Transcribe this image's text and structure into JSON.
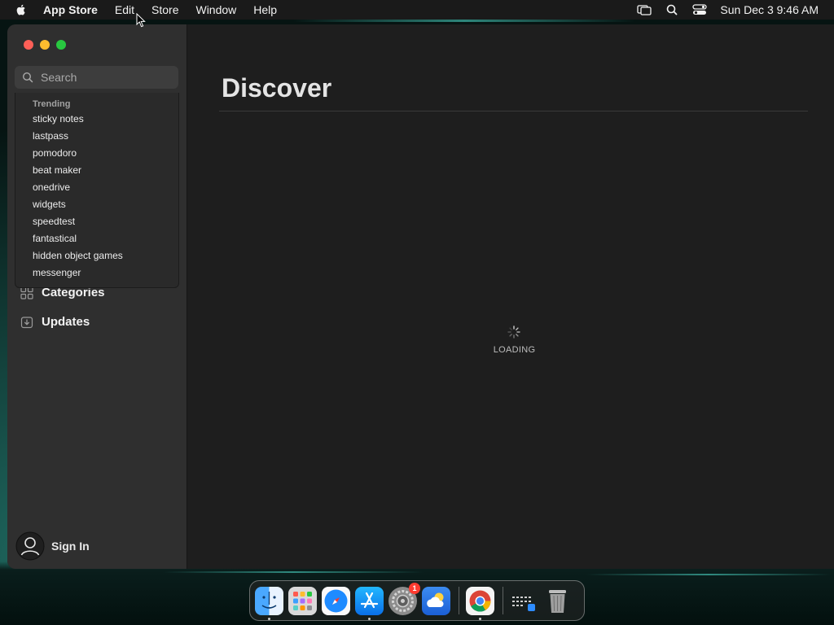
{
  "menubar": {
    "app_name": "App Store",
    "menus": [
      "Edit",
      "Store",
      "Window",
      "Help"
    ],
    "clock": "Sun Dec 3  9:46 AM"
  },
  "sidebar": {
    "search": {
      "placeholder": "Search",
      "value": ""
    },
    "trending": {
      "heading": "Trending",
      "items": [
        "sticky notes",
        "lastpass",
        "pomodoro",
        "beat maker",
        "onedrive",
        "widgets",
        "speedtest",
        "fantastical",
        "hidden object games",
        "messenger"
      ]
    },
    "nav": [
      {
        "label": "Categories",
        "icon": "categories-grid-icon"
      },
      {
        "label": "Updates",
        "icon": "updates-download-icon"
      }
    ],
    "sign_in": "Sign In"
  },
  "main": {
    "title": "Discover",
    "loading": "LOADING"
  },
  "dock": {
    "apps": [
      "finder",
      "launchpad",
      "safari",
      "app-store",
      "system-settings",
      "weather",
      "chrome",
      "downloads",
      "trash"
    ],
    "system_settings_badge": "1"
  },
  "colors": {
    "close": "#fe5f57",
    "minimize": "#febc2e",
    "maximize": "#28c840",
    "sidebar_bg": "#2f2f2f",
    "main_bg": "#1e1e1e"
  }
}
